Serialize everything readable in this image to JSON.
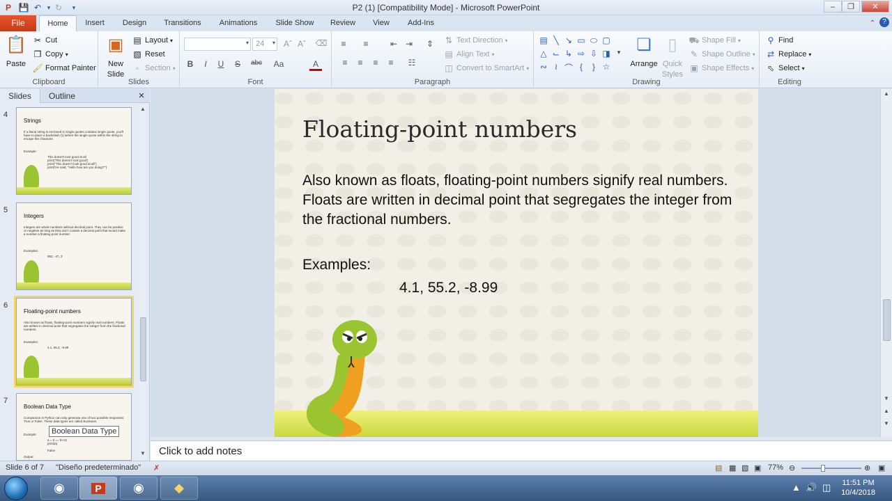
{
  "window": {
    "title": "P2 (1) [Compatibility Mode]  -  Microsoft PowerPoint",
    "minimize_label": "–",
    "maximize_label": "❐",
    "close_label": "✕"
  },
  "tabs": {
    "file": "File",
    "items": [
      {
        "label": "Home"
      },
      {
        "label": "Insert"
      },
      {
        "label": "Design"
      },
      {
        "label": "Transitions"
      },
      {
        "label": "Animations"
      },
      {
        "label": "Slide Show"
      },
      {
        "label": "Review"
      },
      {
        "label": "View"
      },
      {
        "label": "Add-Ins"
      }
    ]
  },
  "ribbon": {
    "clipboard": {
      "label": "Clipboard",
      "paste": "Paste",
      "cut": "Cut",
      "copy": "Copy",
      "format_painter": "Format Painter"
    },
    "slides": {
      "label": "Slides",
      "new_slide": "New",
      "new_slide2": "Slide",
      "layout": "Layout",
      "reset": "Reset",
      "section": "Section"
    },
    "font": {
      "label": "Font",
      "font_name": "",
      "font_size": "24",
      "bold": "B",
      "italic": "I",
      "underline": "U",
      "strike": "S",
      "spacing": "abc",
      "case": "Aa",
      "color": "A"
    },
    "paragraph": {
      "label": "Paragraph",
      "text_direction": "Text Direction",
      "align_text": "Align Text",
      "convert_smartart": "Convert to SmartArt"
    },
    "drawing": {
      "label": "Drawing",
      "arrange": "Arrange",
      "quick_styles": "Quick",
      "quick_styles2": "Styles",
      "shape_fill": "Shape Fill",
      "shape_outline": "Shape Outline",
      "shape_effects": "Shape Effects"
    },
    "editing": {
      "label": "Editing",
      "find": "Find",
      "replace": "Replace",
      "select": "Select"
    }
  },
  "left_pane": {
    "tab_slides": "Slides",
    "tab_outline": "Outline",
    "close": "×",
    "thumbnails": [
      {
        "num": "4",
        "title": "Strings",
        "body": "If a literal string is enclosed in single quotes contains single quote, you'll have to place a backslash (\\) before the single quote within the string to escape the character.",
        "examples": "Example:",
        "code": "This doesn't look good at all.\nprint('This doesn't look good')\nprint(\"This doesn't look good at all\")\nprint('He said, \"Hello how are you doing?\"')"
      },
      {
        "num": "5",
        "title": "Integers",
        "body": "Integers are whole numbers without decimal point. They can be positive or negative as long as they don't contain a decimal point that would make a number a floating point number.",
        "examples": "Examples:",
        "code": "992, -47, 3"
      },
      {
        "num": "6",
        "title": "Floating-point numbers",
        "body": "Also known as floats, floating-point numbers signify real numbers. Floats are written in decimal point that segregates the integer from the fractional numbers.",
        "examples": "Examples:",
        "code": "4.1, 55.2, -8.99"
      },
      {
        "num": "7",
        "title": "Boolean Data Type",
        "body": "Comparison in Python can only generate one of two possible responses: True or False. These data types are called Booleans.",
        "examples": "Example:",
        "code": "a = 5 == 5+12\nprint(a)\n\nFalse"
      }
    ],
    "tooltip": "Boolean Data Type",
    "output_label": "Output:"
  },
  "slide": {
    "title": "Floating-point numbers",
    "body": "Also known as floats, floating-point numbers signify real numbers. Floats are written in decimal point that segregates the integer from the fractional numbers.",
    "examples_label": "Examples:",
    "examples_values": "4.1, 55.2, -8.99"
  },
  "notes": {
    "placeholder": "Click to add notes"
  },
  "status": {
    "slide_info": "Slide 6 of 7",
    "theme": "\"Diseño predeterminado\"",
    "zoom": "77%"
  },
  "taskbar": {
    "time": "11:51 PM",
    "date": "10/4/2018"
  },
  "colors": {
    "file_tab": "#c53b17",
    "ribbon_bg": "#e6edf6",
    "selection_outline": "#f5d36b",
    "grass": "#c9d83e",
    "snake": "#9ac531",
    "taskbar": "#35577f"
  }
}
